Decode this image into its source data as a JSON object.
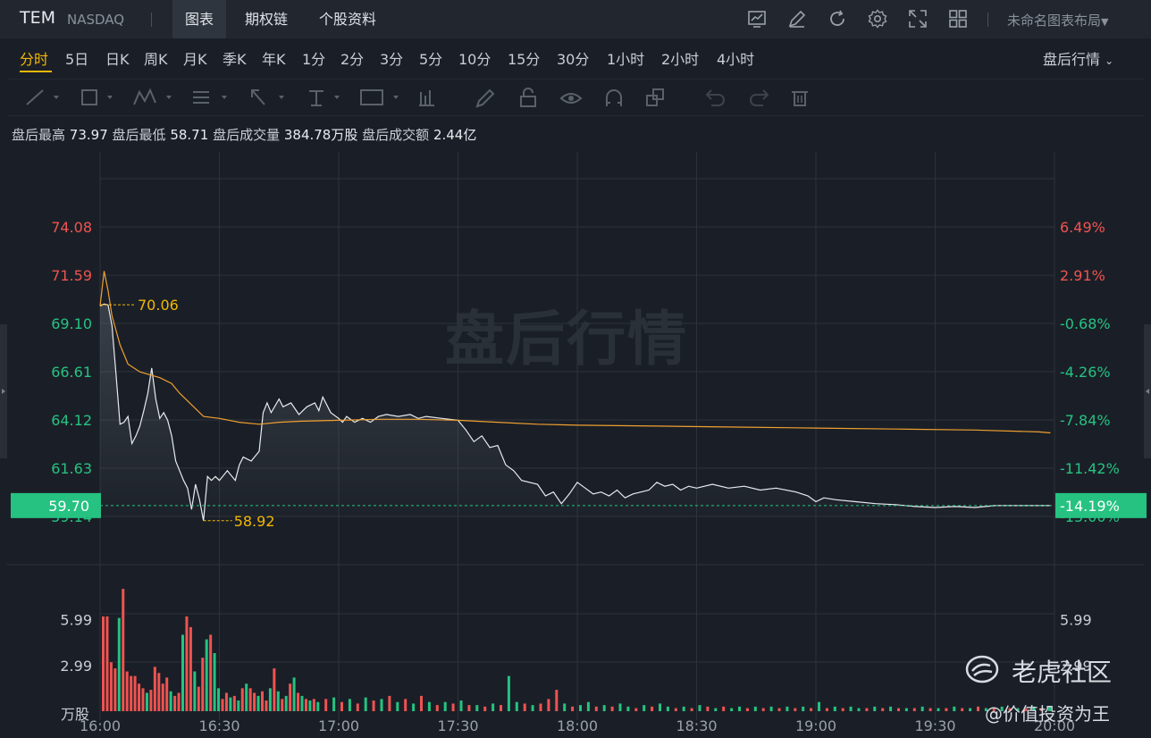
{
  "header": {
    "ticker": "TEM",
    "exchange": "NASDAQ",
    "tabs": [
      {
        "label": "图表",
        "active": true
      },
      {
        "label": "期权链",
        "active": false
      },
      {
        "label": "个股资料",
        "active": false
      }
    ],
    "layout_label": "未命名图表布局"
  },
  "periods": {
    "items": [
      "分时",
      "5日",
      "日K",
      "周K",
      "月K",
      "季K",
      "年K",
      "1分",
      "2分",
      "3分",
      "5分",
      "10分",
      "15分",
      "30分",
      "1小时",
      "2小时",
      "4小时"
    ],
    "active": "分时",
    "session_label": "盘后行情"
  },
  "stats": {
    "high_label": "盘后最高",
    "high_value": "73.97",
    "low_label": "盘后最低",
    "low_value": "58.71",
    "volume_label": "盘后成交量",
    "volume_value": "384.78万股",
    "amount_label": "盘后成交额",
    "amount_value": "2.44亿"
  },
  "watermark": "盘后行情",
  "brand": {
    "name": "老虎社区",
    "sub": "@价值投资为王"
  },
  "colors": {
    "up": "#ef5350",
    "down": "#26c281",
    "line": "#e8ebef",
    "avg": "#f0a030",
    "accent": "#f2b705",
    "grid": "#2c323b"
  },
  "chart_data": {
    "type": "line",
    "title": "",
    "x_ticks": [
      "16:00",
      "16:30",
      "17:00",
      "17:30",
      "18:00",
      "18:30",
      "19:00",
      "19:30",
      "20:00"
    ],
    "price_ticks": [
      {
        "value": "74.08",
        "color": "up"
      },
      {
        "value": "71.59",
        "color": "up"
      },
      {
        "value": "69.10",
        "color": "down"
      },
      {
        "value": "66.61",
        "color": "down"
      },
      {
        "value": "64.12",
        "color": "down"
      },
      {
        "value": "61.63",
        "color": "down"
      },
      {
        "value": "59.14",
        "color": "down"
      }
    ],
    "pct_ticks": [
      {
        "value": "6.49%",
        "color": "up"
      },
      {
        "value": "2.91%",
        "color": "up"
      },
      {
        "value": "-0.68%",
        "color": "down"
      },
      {
        "value": "-4.26%",
        "color": "down"
      },
      {
        "value": "-7.84%",
        "color": "down"
      },
      {
        "value": "-11.42%",
        "color": "down"
      },
      {
        "value": "-15.00%",
        "color": "down"
      }
    ],
    "price_range": [
      59.14,
      74.08
    ],
    "current_price": "59.70",
    "current_pct": "-14.19%",
    "high_marker": {
      "label": "70.06",
      "price": 70.06,
      "time_min": 0
    },
    "low_marker": {
      "label": "58.92",
      "price": 58.92,
      "time_min": 26
    },
    "volume_ticks": [
      "5.99",
      "2.99"
    ],
    "volume_unit": "万股",
    "volume_max": 9.0,
    "price_series": [
      [
        0,
        70.0
      ],
      [
        1,
        70.1
      ],
      [
        2,
        70.06
      ],
      [
        3,
        69.0
      ],
      [
        4,
        66.5
      ],
      [
        5,
        63.9
      ],
      [
        6,
        64.0
      ],
      [
        7,
        64.3
      ],
      [
        8,
        62.9
      ],
      [
        9,
        63.3
      ],
      [
        10,
        63.8
      ],
      [
        11,
        64.6
      ],
      [
        12,
        65.5
      ],
      [
        13,
        66.8
      ],
      [
        14,
        65.2
      ],
      [
        15,
        64.2
      ],
      [
        16,
        64.5
      ],
      [
        17,
        64.1
      ],
      [
        18,
        63.3
      ],
      [
        19,
        62.0
      ],
      [
        20,
        61.5
      ],
      [
        21,
        61.0
      ],
      [
        22,
        60.6
      ],
      [
        23,
        59.5
      ],
      [
        24,
        60.8
      ],
      [
        25,
        60.0
      ],
      [
        26,
        58.92
      ],
      [
        27,
        61.2
      ],
      [
        28,
        61.0
      ],
      [
        29,
        61.2
      ],
      [
        30,
        61.0
      ],
      [
        32,
        61.5
      ],
      [
        34,
        61.0
      ],
      [
        35,
        61.8
      ],
      [
        36,
        62.2
      ],
      [
        38,
        62.0
      ],
      [
        40,
        62.5
      ],
      [
        41,
        64.5
      ],
      [
        42,
        65.0
      ],
      [
        43,
        64.5
      ],
      [
        45,
        65.2
      ],
      [
        46,
        64.8
      ],
      [
        48,
        65.0
      ],
      [
        50,
        64.4
      ],
      [
        52,
        64.8
      ],
      [
        54,
        65.0
      ],
      [
        55,
        64.6
      ],
      [
        56,
        65.3
      ],
      [
        58,
        64.5
      ],
      [
        60,
        64.2
      ],
      [
        61,
        64.0
      ],
      [
        62,
        64.3
      ],
      [
        64,
        64.0
      ],
      [
        66,
        64.2
      ],
      [
        68,
        64.0
      ],
      [
        70,
        64.3
      ],
      [
        72,
        64.4
      ],
      [
        75,
        64.3
      ],
      [
        78,
        64.4
      ],
      [
        80,
        64.2
      ],
      [
        82,
        64.3
      ],
      [
        86,
        64.2
      ],
      [
        90,
        64.1
      ],
      [
        92,
        63.6
      ],
      [
        94,
        63.0
      ],
      [
        96,
        63.3
      ],
      [
        98,
        62.7
      ],
      [
        100,
        62.8
      ],
      [
        102,
        61.8
      ],
      [
        104,
        61.5
      ],
      [
        106,
        61.0
      ],
      [
        110,
        60.8
      ],
      [
        112,
        60.2
      ],
      [
        114,
        60.4
      ],
      [
        116,
        59.8
      ],
      [
        118,
        60.3
      ],
      [
        120,
        60.9
      ],
      [
        122,
        60.6
      ],
      [
        124,
        60.3
      ],
      [
        126,
        60.4
      ],
      [
        128,
        60.2
      ],
      [
        130,
        60.5
      ],
      [
        132,
        60.1
      ],
      [
        134,
        60.3
      ],
      [
        136,
        60.4
      ],
      [
        138,
        60.5
      ],
      [
        140,
        60.9
      ],
      [
        142,
        60.7
      ],
      [
        144,
        60.8
      ],
      [
        146,
        60.5
      ],
      [
        148,
        60.7
      ],
      [
        150,
        60.6
      ],
      [
        154,
        60.8
      ],
      [
        158,
        60.6
      ],
      [
        162,
        60.7
      ],
      [
        166,
        60.5
      ],
      [
        170,
        60.6
      ],
      [
        175,
        60.4
      ],
      [
        178,
        60.2
      ],
      [
        180,
        59.9
      ],
      [
        182,
        60.1
      ],
      [
        185,
        60.0
      ],
      [
        190,
        59.9
      ],
      [
        195,
        59.8
      ],
      [
        200,
        59.75
      ],
      [
        205,
        59.65
      ],
      [
        210,
        59.6
      ],
      [
        215,
        59.65
      ],
      [
        220,
        59.6
      ],
      [
        225,
        59.7
      ],
      [
        239,
        59.7
      ]
    ],
    "avg_series": [
      [
        0,
        70.0
      ],
      [
        1,
        71.8
      ],
      [
        2,
        70.8
      ],
      [
        3,
        69.5
      ],
      [
        5,
        68.0
      ],
      [
        7,
        67.0
      ],
      [
        10,
        66.6
      ],
      [
        15,
        66.3
      ],
      [
        18,
        66.0
      ],
      [
        20,
        65.5
      ],
      [
        23,
        64.9
      ],
      [
        26,
        64.3
      ],
      [
        30,
        64.2
      ],
      [
        35,
        64.0
      ],
      [
        40,
        63.9
      ],
      [
        45,
        64.0
      ],
      [
        50,
        64.05
      ],
      [
        60,
        64.1
      ],
      [
        70,
        64.15
      ],
      [
        80,
        64.15
      ],
      [
        90,
        64.1
      ],
      [
        100,
        64.0
      ],
      [
        110,
        63.9
      ],
      [
        120,
        63.85
      ],
      [
        140,
        63.8
      ],
      [
        160,
        63.75
      ],
      [
        180,
        63.7
      ],
      [
        200,
        63.65
      ],
      [
        220,
        63.6
      ],
      [
        236,
        63.5
      ],
      [
        239,
        63.45
      ]
    ],
    "volume_series": [
      [
        0,
        6.2,
        "up"
      ],
      [
        1,
        6.2,
        "up"
      ],
      [
        2,
        3.2,
        "up"
      ],
      [
        3,
        2.8,
        "up"
      ],
      [
        4,
        6.1,
        "down"
      ],
      [
        5,
        8.0,
        "up"
      ],
      [
        6,
        2.6,
        "up"
      ],
      [
        7,
        2.3,
        "up"
      ],
      [
        8,
        2.3,
        "up"
      ],
      [
        9,
        1.8,
        "up"
      ],
      [
        10,
        1.5,
        "up"
      ],
      [
        11,
        1.2,
        "down"
      ],
      [
        12,
        1.4,
        "up"
      ],
      [
        13,
        2.9,
        "up"
      ],
      [
        14,
        2.5,
        "up"
      ],
      [
        15,
        1.8,
        "up"
      ],
      [
        16,
        2.2,
        "up"
      ],
      [
        17,
        1.3,
        "down"
      ],
      [
        18,
        1.0,
        "up"
      ],
      [
        19,
        1.2,
        "up"
      ],
      [
        20,
        5.0,
        "down"
      ],
      [
        21,
        6.2,
        "up"
      ],
      [
        22,
        5.5,
        "up"
      ],
      [
        23,
        2.6,
        "down"
      ],
      [
        24,
        1.6,
        "up"
      ],
      [
        25,
        3.5,
        "up"
      ],
      [
        26,
        4.7,
        "down"
      ],
      [
        27,
        5.0,
        "up"
      ],
      [
        28,
        3.8,
        "down"
      ],
      [
        29,
        1.5,
        "down"
      ],
      [
        30,
        0.8,
        "up"
      ],
      [
        31,
        1.2,
        "up"
      ],
      [
        32,
        0.9,
        "down"
      ],
      [
        33,
        1.0,
        "up"
      ],
      [
        34,
        0.7,
        "down"
      ],
      [
        35,
        1.5,
        "up"
      ],
      [
        36,
        1.8,
        "down"
      ],
      [
        37,
        1.5,
        "up"
      ],
      [
        38,
        1.2,
        "up"
      ],
      [
        39,
        1.0,
        "down"
      ],
      [
        40,
        1.3,
        "up"
      ],
      [
        41,
        0.7,
        "up"
      ],
      [
        42,
        1.5,
        "down"
      ],
      [
        43,
        2.8,
        "up"
      ],
      [
        44,
        1.3,
        "down"
      ],
      [
        45,
        0.8,
        "up"
      ],
      [
        46,
        1.0,
        "down"
      ],
      [
        47,
        1.8,
        "up"
      ],
      [
        48,
        2.2,
        "down"
      ],
      [
        49,
        1.2,
        "up"
      ],
      [
        50,
        1.0,
        "down"
      ],
      [
        51,
        0.8,
        "up"
      ],
      [
        52,
        0.7,
        "down"
      ],
      [
        53,
        0.8,
        "up"
      ],
      [
        54,
        0.6,
        "down"
      ],
      [
        56,
        0.8,
        "up"
      ],
      [
        58,
        0.9,
        "down"
      ],
      [
        60,
        0.6,
        "up"
      ],
      [
        62,
        0.8,
        "down"
      ],
      [
        64,
        0.5,
        "up"
      ],
      [
        66,
        0.9,
        "down"
      ],
      [
        68,
        0.7,
        "up"
      ],
      [
        70,
        0.8,
        "down"
      ],
      [
        72,
        1.0,
        "up"
      ],
      [
        74,
        0.6,
        "down"
      ],
      [
        76,
        0.8,
        "up"
      ],
      [
        78,
        0.5,
        "down"
      ],
      [
        80,
        1.0,
        "up"
      ],
      [
        82,
        0.6,
        "down"
      ],
      [
        84,
        0.4,
        "up"
      ],
      [
        86,
        0.6,
        "down"
      ],
      [
        88,
        0.5,
        "up"
      ],
      [
        90,
        0.7,
        "down"
      ],
      [
        92,
        0.4,
        "up"
      ],
      [
        94,
        0.4,
        "down"
      ],
      [
        96,
        0.3,
        "up"
      ],
      [
        98,
        0.5,
        "down"
      ],
      [
        100,
        0.4,
        "up"
      ],
      [
        102,
        2.3,
        "down"
      ],
      [
        104,
        0.6,
        "down"
      ],
      [
        106,
        0.5,
        "up"
      ],
      [
        108,
        0.4,
        "down"
      ],
      [
        110,
        0.5,
        "up"
      ],
      [
        112,
        0.8,
        "up"
      ],
      [
        114,
        1.4,
        "up"
      ],
      [
        116,
        0.5,
        "down"
      ],
      [
        118,
        0.3,
        "up"
      ],
      [
        120,
        0.4,
        "down"
      ],
      [
        122,
        0.6,
        "down"
      ],
      [
        124,
        0.3,
        "up"
      ],
      [
        126,
        0.4,
        "down"
      ],
      [
        128,
        0.3,
        "up"
      ],
      [
        130,
        0.5,
        "down"
      ],
      [
        132,
        0.3,
        "down"
      ],
      [
        134,
        0.2,
        "up"
      ],
      [
        136,
        0.4,
        "down"
      ],
      [
        138,
        0.3,
        "up"
      ],
      [
        140,
        0.5,
        "down"
      ],
      [
        142,
        0.3,
        "down"
      ],
      [
        144,
        0.2,
        "up"
      ],
      [
        146,
        0.3,
        "down"
      ],
      [
        148,
        0.2,
        "up"
      ],
      [
        150,
        0.4,
        "down"
      ],
      [
        152,
        0.3,
        "up"
      ],
      [
        154,
        0.2,
        "down"
      ],
      [
        156,
        0.3,
        "up"
      ],
      [
        158,
        0.2,
        "down"
      ],
      [
        160,
        0.3,
        "down"
      ],
      [
        162,
        0.2,
        "up"
      ],
      [
        164,
        0.3,
        "down"
      ],
      [
        166,
        0.2,
        "up"
      ],
      [
        168,
        0.3,
        "down"
      ],
      [
        170,
        0.2,
        "up"
      ],
      [
        172,
        0.3,
        "down"
      ],
      [
        174,
        0.2,
        "up"
      ],
      [
        176,
        0.3,
        "down"
      ],
      [
        178,
        0.2,
        "up"
      ],
      [
        180,
        0.6,
        "down"
      ],
      [
        182,
        0.2,
        "up"
      ],
      [
        184,
        0.3,
        "down"
      ],
      [
        186,
        0.2,
        "up"
      ],
      [
        188,
        0.3,
        "down"
      ],
      [
        190,
        0.2,
        "down"
      ],
      [
        192,
        0.2,
        "up"
      ],
      [
        194,
        0.3,
        "down"
      ],
      [
        196,
        0.2,
        "up"
      ],
      [
        198,
        0.3,
        "down"
      ],
      [
        200,
        0.2,
        "up"
      ],
      [
        202,
        0.2,
        "down"
      ],
      [
        204,
        0.2,
        "up"
      ],
      [
        206,
        0.3,
        "down"
      ],
      [
        208,
        0.2,
        "up"
      ],
      [
        210,
        0.2,
        "down"
      ],
      [
        212,
        0.2,
        "up"
      ],
      [
        214,
        0.3,
        "down"
      ],
      [
        216,
        0.2,
        "up"
      ],
      [
        218,
        0.2,
        "down"
      ],
      [
        220,
        0.3,
        "up"
      ],
      [
        222,
        0.2,
        "down"
      ],
      [
        224,
        0.2,
        "up"
      ],
      [
        226,
        0.3,
        "down"
      ],
      [
        228,
        0.2,
        "up"
      ],
      [
        230,
        0.2,
        "down"
      ],
      [
        232,
        0.2,
        "up"
      ],
      [
        234,
        0.3,
        "down"
      ],
      [
        236,
        0.2,
        "up"
      ],
      [
        238,
        0.3,
        "down"
      ]
    ]
  }
}
